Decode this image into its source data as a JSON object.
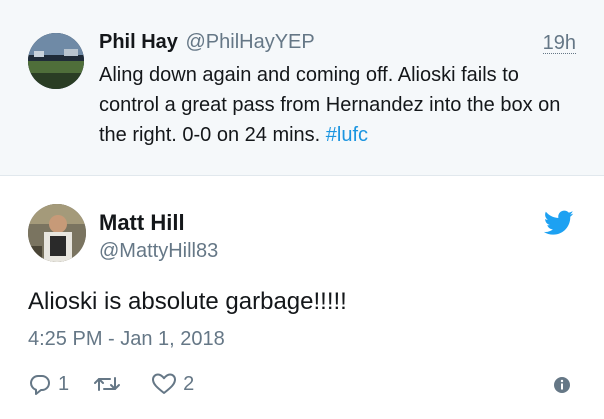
{
  "parent_tweet": {
    "author_name": "Phil Hay",
    "author_handle": "@PhilHayYEP",
    "time": "19h",
    "text_main": "Aling down again and coming off. Alioski fails to control a great pass from Hernandez into the box on the right. 0-0 on 24 mins.",
    "hashtag": "#lufc"
  },
  "main_tweet": {
    "author_name": "Matt Hill",
    "author_handle": "@MattyHill83",
    "text": "Alioski is absolute garbage!!!!!",
    "timestamp": "4:25 PM - Jan 1, 2018",
    "reply_count": "1",
    "retweet_count": "",
    "like_count": "2"
  },
  "icons": {
    "brand": "twitter-bird-icon",
    "reply": "reply-icon",
    "retweet": "retweet-icon",
    "like": "heart-icon",
    "info": "info-icon"
  },
  "colors": {
    "accent": "#1da1f2",
    "hashtag": "#1b95e0",
    "secondary_text": "#657786",
    "parent_background": "#f5f8fa"
  }
}
